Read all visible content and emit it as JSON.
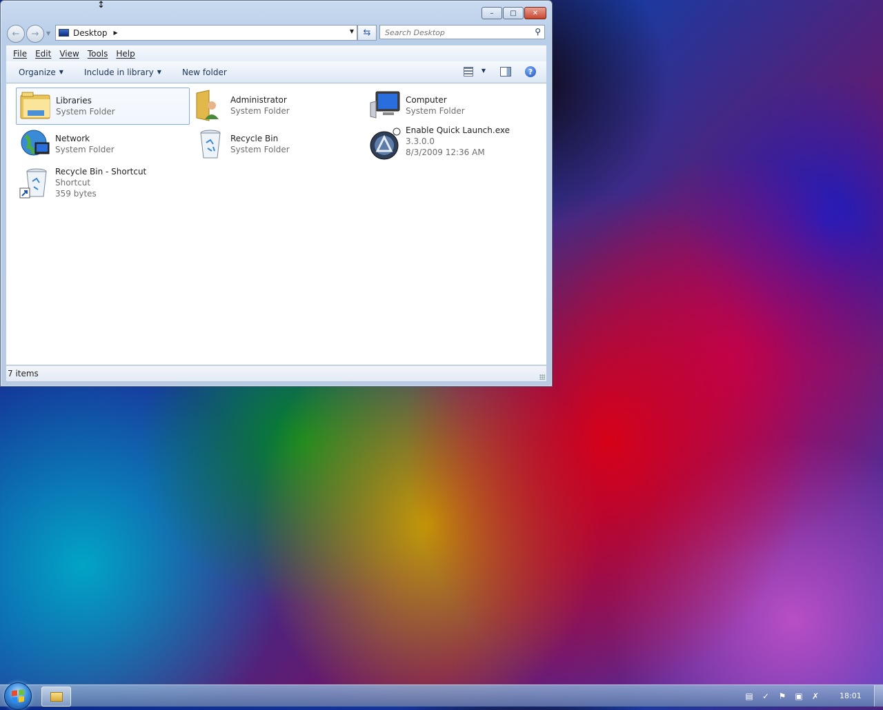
{
  "window": {
    "address": {
      "crumb": "Desktop"
    },
    "search": {
      "placeholder": "Search Desktop"
    },
    "menu": [
      "File",
      "Edit",
      "View",
      "Tools",
      "Help"
    ],
    "commands": {
      "organize": "Organize",
      "include": "Include in library",
      "new_folder": "New folder"
    },
    "items": [
      {
        "name": "Libraries",
        "lines": [
          "System Folder"
        ],
        "icon": "libraries-icon"
      },
      {
        "name": "Administrator",
        "lines": [
          "System Folder"
        ],
        "icon": "user-folder-icon"
      },
      {
        "name": "Computer",
        "lines": [
          "System Folder"
        ],
        "icon": "computer-icon"
      },
      {
        "name": "Network",
        "lines": [
          "System Folder"
        ],
        "icon": "network-icon"
      },
      {
        "name": "Recycle Bin",
        "lines": [
          "System Folder"
        ],
        "icon": "recycle-bin-icon"
      },
      {
        "name": "Enable Quick Launch.exe",
        "lines": [
          "3.3.0.0",
          "8/3/2009 12:36 AM"
        ],
        "icon": "app-icon"
      },
      {
        "name": "Recycle Bin - Shortcut",
        "lines": [
          "Shortcut",
          "359 bytes"
        ],
        "icon": "recycle-bin-shortcut-icon"
      }
    ],
    "status": "7 items"
  },
  "taskbar": {
    "clock": "18:01"
  },
  "colors": {
    "selection_border": "#84acdd",
    "close_button": "#c8452f",
    "secondary_text": "#6d6d6d"
  }
}
